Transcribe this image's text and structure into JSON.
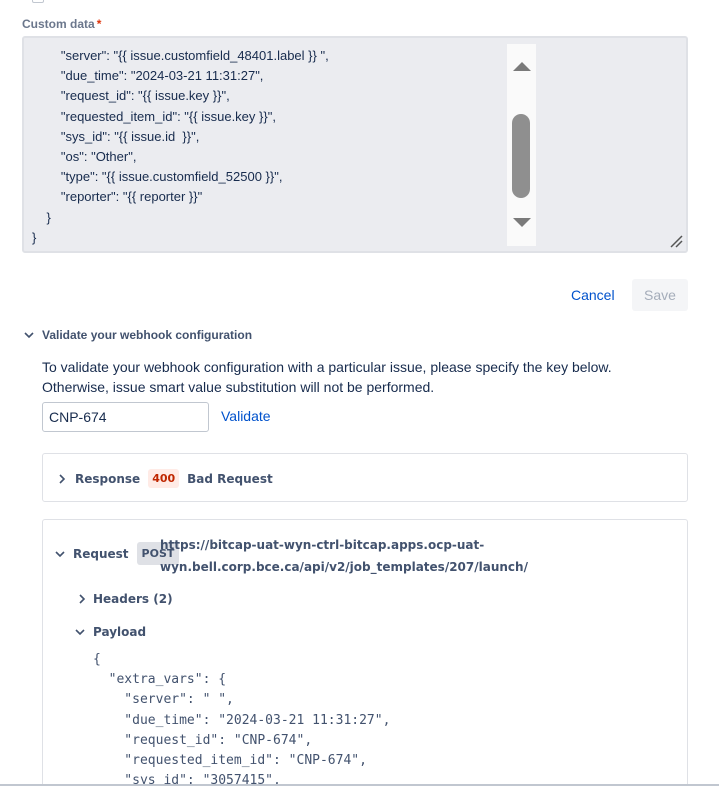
{
  "custom_data": {
    "label": "Custom data",
    "required_mark": "*",
    "value": "        \"server\": \"{{ issue.customfield_48401.label }} \",\n        \"due_time\": \"2024-03-21 11:31:27\",\n        \"request_id\": \"{{ issue.key }}\",\n        \"requested_item_id\": \"{{ issue.key }}\",\n        \"sys_id\": \"{{ issue.id  }}\",\n        \"os\": \"Other\",\n        \"type\": \"{{ issue.customfield_52500 }}\",\n        \"reporter\": \"{{ reporter }}\"\n    }\n}"
  },
  "actions": {
    "cancel_label": "Cancel",
    "save_label": "Save"
  },
  "validate_section": {
    "title": "Validate your webhook configuration",
    "help_line1": "To validate your webhook configuration with a particular issue, please specify the key below.",
    "help_line2": "Otherwise, issue smart value substitution will not be performed.",
    "issue_key_value": "CNP-674",
    "validate_label": "Validate"
  },
  "response": {
    "label": "Response",
    "status_code": "400",
    "status_text": "Bad Request"
  },
  "request": {
    "label": "Request",
    "method": "POST",
    "url_line1": "https://bitcap-uat-wyn-ctrl-bitcap.apps.ocp-uat-",
    "url_line2": "wyn.bell.corp.bce.ca/api/v2/job_templates/207/launch/",
    "headers_label": "Headers (2)",
    "payload_label": "Payload",
    "payload_text": "{\n  \"extra_vars\": {\n    \"server\": \" \",\n    \"due_time\": \"2024-03-21 11:31:27\",\n    \"request_id\": \"CNP-674\",\n    \"requested_item_id\": \"CNP-674\",\n    \"sys_id\": \"3057415\","
  },
  "colors": {
    "link": "#0052cc",
    "error_badge_bg": "#ffebe6",
    "error_badge_text": "#bf2600",
    "required": "#de350b"
  }
}
